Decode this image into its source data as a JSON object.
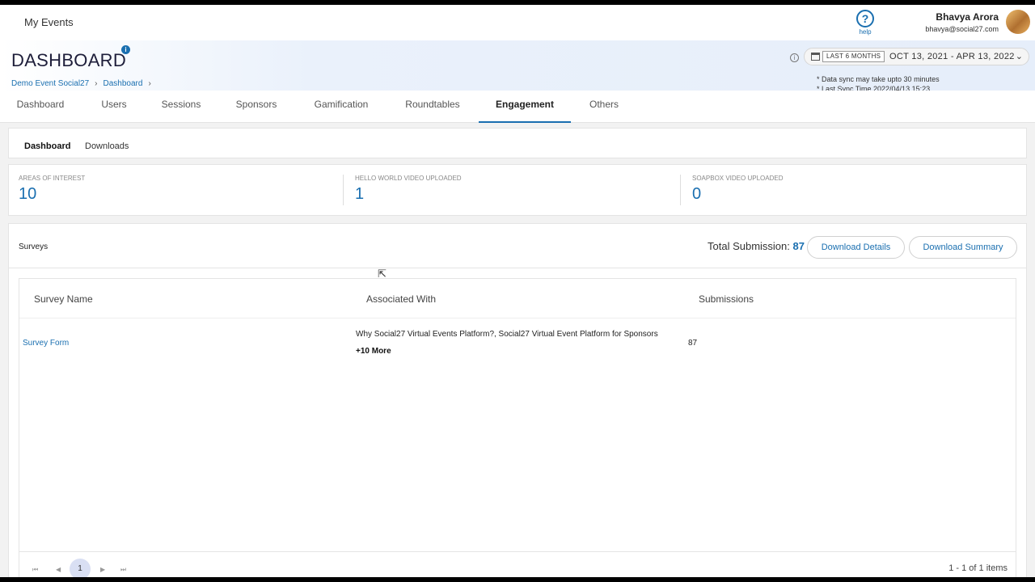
{
  "topbar": {
    "my_events": "My Events",
    "help_label": "help",
    "user_name": "Bhavya Arora",
    "user_email": "bhavya@social27.com"
  },
  "header": {
    "title": "DASHBOARD",
    "breadcrumb": [
      "Demo Event Social27",
      "Dashboard"
    ],
    "range_pill": "LAST 6 MONTHS",
    "range_dates": "OCT 13, 2021 - APR 13, 2022",
    "sync_note_1": "* Data sync may take upto 30 minutes",
    "sync_note_2": "* Last Sync Time 2022/04/13 15:23"
  },
  "main_tabs": [
    "Dashboard",
    "Users",
    "Sessions",
    "Sponsors",
    "Gamification",
    "Roundtables",
    "Engagement",
    "Others"
  ],
  "sub_tabs": [
    "Dashboard",
    "Downloads"
  ],
  "stats": [
    {
      "label": "AREAS OF INTEREST",
      "value": "10"
    },
    {
      "label": "HELLO WORLD VIDEO UPLOADED",
      "value": "1"
    },
    {
      "label": "SOAPBOX VIDEO UPLOADED",
      "value": "0"
    }
  ],
  "surveys": {
    "title": "Surveys",
    "total_label": "Total Submission:",
    "total_value": "87",
    "download_details": "Download Details",
    "download_summary": "Download Summary",
    "columns": [
      "Survey Name",
      "Associated With",
      "Submissions"
    ],
    "row": {
      "name": "Survey Form",
      "associated": "Why Social27 Virtual Events Platform?, Social27 Virtual Event Platform for Sponsors",
      "more": "+10 More",
      "submissions": "87"
    },
    "pager": {
      "first": "⏮",
      "prev": "◀",
      "page": "1",
      "next": "▶",
      "last": "⏭",
      "info": "1 - 1 of 1 items"
    }
  },
  "colors": {
    "accent": "#1a6fb0",
    "active_page": "#d9dff3"
  }
}
